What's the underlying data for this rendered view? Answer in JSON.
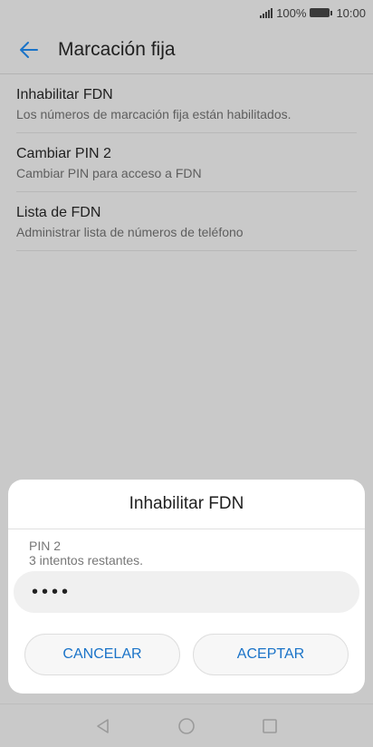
{
  "status_bar": {
    "battery_percent": "100%",
    "time": "10:00"
  },
  "header": {
    "title": "Marcación fija"
  },
  "settings": [
    {
      "title": "Inhabilitar FDN",
      "subtitle": "Los números de marcación fija están habilitados."
    },
    {
      "title": "Cambiar PIN 2",
      "subtitle": "Cambiar PIN para acceso a FDN"
    },
    {
      "title": "Lista de FDN",
      "subtitle": "Administrar lista de números de teléfono"
    }
  ],
  "dialog": {
    "title": "Inhabilitar FDN",
    "label_line1": "PIN 2",
    "label_line2": "3 intentos restantes.",
    "pin_value": "••••",
    "cancel_label": "CANCELAR",
    "accept_label": "ACEPTAR"
  },
  "colors": {
    "accent": "#1a73c8",
    "scrim": "#c9c9c9"
  },
  "icons": {
    "back": "arrow-left-icon",
    "nav_back": "triangle-back-icon",
    "nav_home": "circle-home-icon",
    "nav_recents": "square-recents-icon"
  }
}
